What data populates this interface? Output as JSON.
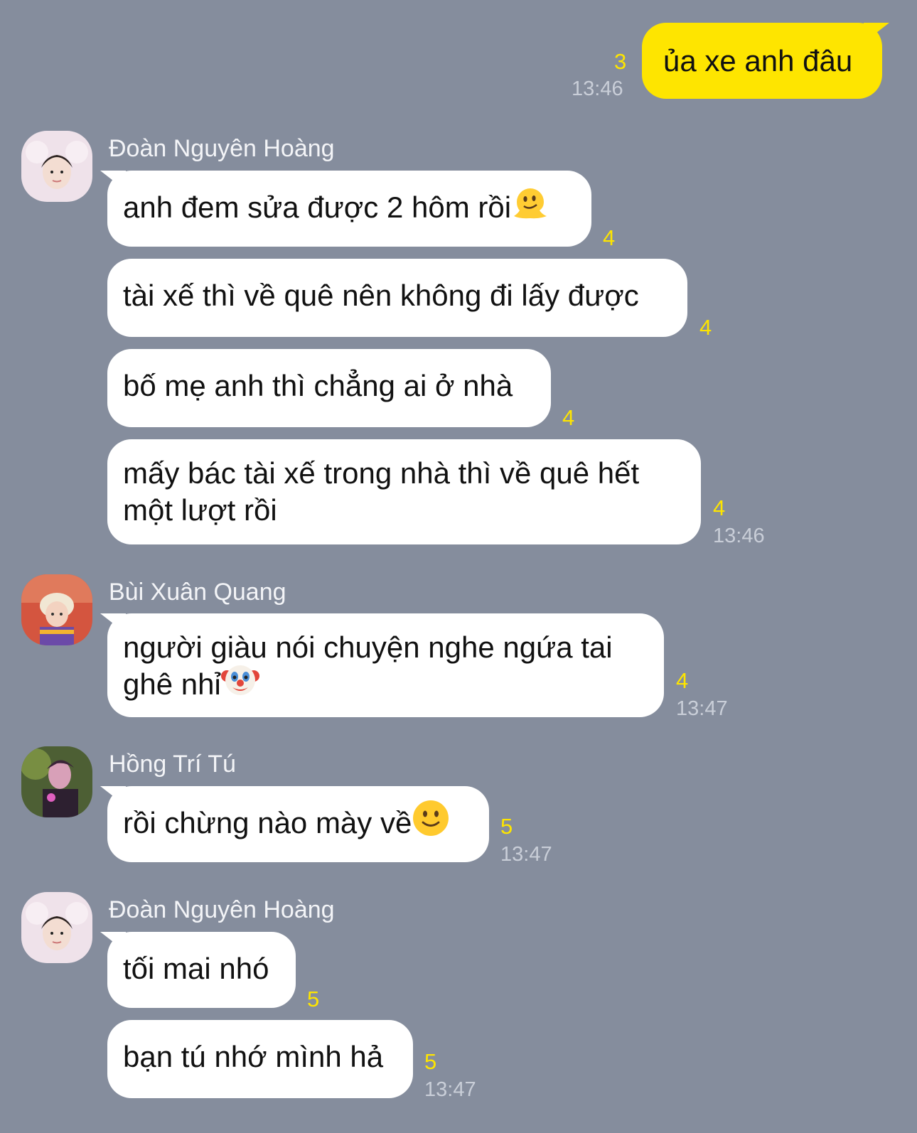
{
  "colors": {
    "background": "#858d9d",
    "my_bubble": "#fee500",
    "other_bubble": "#ffffff",
    "unread_count": "#fee500",
    "timestamp": "#c9ced8"
  },
  "messages": [
    {
      "sender": "me",
      "text": "ủa xe anh đâu",
      "unread": "3",
      "time": "13:46"
    },
    {
      "sender": "Đoàn Nguyên Hoàng",
      "avatar": "avatar-hoang",
      "text": "anh đem sửa được 2 hôm rồi",
      "emoji": "melting-face-emoji",
      "unread": "4"
    },
    {
      "text": "tài xế thì về quê nên không đi lấy được",
      "unread": "4"
    },
    {
      "text": "bố mẹ anh thì chẳng ai ở nhà",
      "unread": "4"
    },
    {
      "text": "mấy bác tài xế trong nhà thì về quê hết một lượt rồi",
      "unread": "4",
      "time": "13:46"
    },
    {
      "sender": "Bùi Xuân Quang",
      "avatar": "avatar-quang",
      "text": "người giàu nói chuyện nghe ngứa tai ghê nhỉ",
      "emoji": "clown-face-emoji",
      "unread": "4",
      "time": "13:47"
    },
    {
      "sender": "Hồng Trí Tú",
      "avatar": "avatar-tu",
      "text": "rồi chừng nào mày về",
      "emoji": "slightly-smiling-face-emoji",
      "unread": "5",
      "time": "13:47"
    },
    {
      "sender": "Đoàn Nguyên Hoàng",
      "avatar": "avatar-hoang",
      "text": "tối mai nhó",
      "unread": "5"
    },
    {
      "text": "bạn tú nhớ mình hả",
      "unread": "5",
      "time": "13:47"
    }
  ]
}
